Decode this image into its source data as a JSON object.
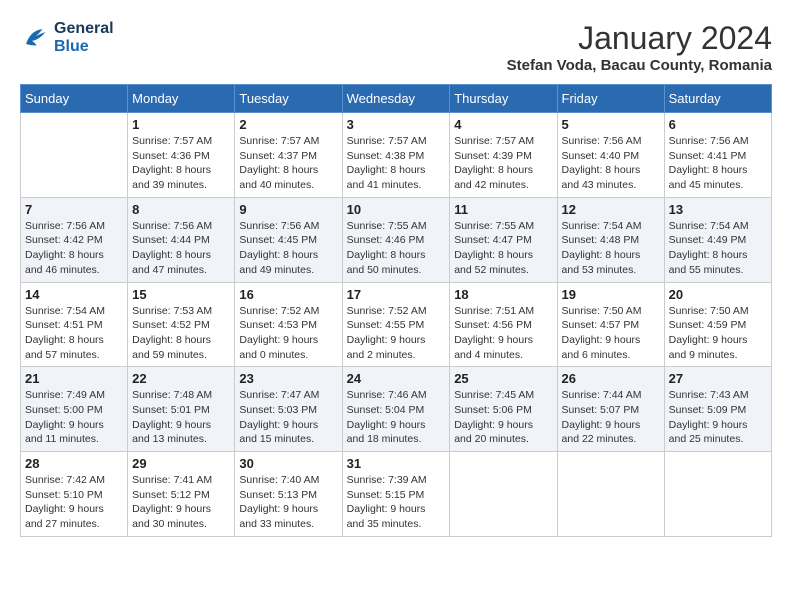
{
  "logo": {
    "line1": "General",
    "line2": "Blue"
  },
  "title": "January 2024",
  "location": "Stefan Voda, Bacau County, Romania",
  "weekdays": [
    "Sunday",
    "Monday",
    "Tuesday",
    "Wednesday",
    "Thursday",
    "Friday",
    "Saturday"
  ],
  "weeks": [
    [
      {
        "day": "",
        "sunrise": "",
        "sunset": "",
        "daylight": ""
      },
      {
        "day": "1",
        "sunrise": "Sunrise: 7:57 AM",
        "sunset": "Sunset: 4:36 PM",
        "daylight": "Daylight: 8 hours and 39 minutes."
      },
      {
        "day": "2",
        "sunrise": "Sunrise: 7:57 AM",
        "sunset": "Sunset: 4:37 PM",
        "daylight": "Daylight: 8 hours and 40 minutes."
      },
      {
        "day": "3",
        "sunrise": "Sunrise: 7:57 AM",
        "sunset": "Sunset: 4:38 PM",
        "daylight": "Daylight: 8 hours and 41 minutes."
      },
      {
        "day": "4",
        "sunrise": "Sunrise: 7:57 AM",
        "sunset": "Sunset: 4:39 PM",
        "daylight": "Daylight: 8 hours and 42 minutes."
      },
      {
        "day": "5",
        "sunrise": "Sunrise: 7:56 AM",
        "sunset": "Sunset: 4:40 PM",
        "daylight": "Daylight: 8 hours and 43 minutes."
      },
      {
        "day": "6",
        "sunrise": "Sunrise: 7:56 AM",
        "sunset": "Sunset: 4:41 PM",
        "daylight": "Daylight: 8 hours and 45 minutes."
      }
    ],
    [
      {
        "day": "7",
        "sunrise": "Sunrise: 7:56 AM",
        "sunset": "Sunset: 4:42 PM",
        "daylight": "Daylight: 8 hours and 46 minutes."
      },
      {
        "day": "8",
        "sunrise": "Sunrise: 7:56 AM",
        "sunset": "Sunset: 4:44 PM",
        "daylight": "Daylight: 8 hours and 47 minutes."
      },
      {
        "day": "9",
        "sunrise": "Sunrise: 7:56 AM",
        "sunset": "Sunset: 4:45 PM",
        "daylight": "Daylight: 8 hours and 49 minutes."
      },
      {
        "day": "10",
        "sunrise": "Sunrise: 7:55 AM",
        "sunset": "Sunset: 4:46 PM",
        "daylight": "Daylight: 8 hours and 50 minutes."
      },
      {
        "day": "11",
        "sunrise": "Sunrise: 7:55 AM",
        "sunset": "Sunset: 4:47 PM",
        "daylight": "Daylight: 8 hours and 52 minutes."
      },
      {
        "day": "12",
        "sunrise": "Sunrise: 7:54 AM",
        "sunset": "Sunset: 4:48 PM",
        "daylight": "Daylight: 8 hours and 53 minutes."
      },
      {
        "day": "13",
        "sunrise": "Sunrise: 7:54 AM",
        "sunset": "Sunset: 4:49 PM",
        "daylight": "Daylight: 8 hours and 55 minutes."
      }
    ],
    [
      {
        "day": "14",
        "sunrise": "Sunrise: 7:54 AM",
        "sunset": "Sunset: 4:51 PM",
        "daylight": "Daylight: 8 hours and 57 minutes."
      },
      {
        "day": "15",
        "sunrise": "Sunrise: 7:53 AM",
        "sunset": "Sunset: 4:52 PM",
        "daylight": "Daylight: 8 hours and 59 minutes."
      },
      {
        "day": "16",
        "sunrise": "Sunrise: 7:52 AM",
        "sunset": "Sunset: 4:53 PM",
        "daylight": "Daylight: 9 hours and 0 minutes."
      },
      {
        "day": "17",
        "sunrise": "Sunrise: 7:52 AM",
        "sunset": "Sunset: 4:55 PM",
        "daylight": "Daylight: 9 hours and 2 minutes."
      },
      {
        "day": "18",
        "sunrise": "Sunrise: 7:51 AM",
        "sunset": "Sunset: 4:56 PM",
        "daylight": "Daylight: 9 hours and 4 minutes."
      },
      {
        "day": "19",
        "sunrise": "Sunrise: 7:50 AM",
        "sunset": "Sunset: 4:57 PM",
        "daylight": "Daylight: 9 hours and 6 minutes."
      },
      {
        "day": "20",
        "sunrise": "Sunrise: 7:50 AM",
        "sunset": "Sunset: 4:59 PM",
        "daylight": "Daylight: 9 hours and 9 minutes."
      }
    ],
    [
      {
        "day": "21",
        "sunrise": "Sunrise: 7:49 AM",
        "sunset": "Sunset: 5:00 PM",
        "daylight": "Daylight: 9 hours and 11 minutes."
      },
      {
        "day": "22",
        "sunrise": "Sunrise: 7:48 AM",
        "sunset": "Sunset: 5:01 PM",
        "daylight": "Daylight: 9 hours and 13 minutes."
      },
      {
        "day": "23",
        "sunrise": "Sunrise: 7:47 AM",
        "sunset": "Sunset: 5:03 PM",
        "daylight": "Daylight: 9 hours and 15 minutes."
      },
      {
        "day": "24",
        "sunrise": "Sunrise: 7:46 AM",
        "sunset": "Sunset: 5:04 PM",
        "daylight": "Daylight: 9 hours and 18 minutes."
      },
      {
        "day": "25",
        "sunrise": "Sunrise: 7:45 AM",
        "sunset": "Sunset: 5:06 PM",
        "daylight": "Daylight: 9 hours and 20 minutes."
      },
      {
        "day": "26",
        "sunrise": "Sunrise: 7:44 AM",
        "sunset": "Sunset: 5:07 PM",
        "daylight": "Daylight: 9 hours and 22 minutes."
      },
      {
        "day": "27",
        "sunrise": "Sunrise: 7:43 AM",
        "sunset": "Sunset: 5:09 PM",
        "daylight": "Daylight: 9 hours and 25 minutes."
      }
    ],
    [
      {
        "day": "28",
        "sunrise": "Sunrise: 7:42 AM",
        "sunset": "Sunset: 5:10 PM",
        "daylight": "Daylight: 9 hours and 27 minutes."
      },
      {
        "day": "29",
        "sunrise": "Sunrise: 7:41 AM",
        "sunset": "Sunset: 5:12 PM",
        "daylight": "Daylight: 9 hours and 30 minutes."
      },
      {
        "day": "30",
        "sunrise": "Sunrise: 7:40 AM",
        "sunset": "Sunset: 5:13 PM",
        "daylight": "Daylight: 9 hours and 33 minutes."
      },
      {
        "day": "31",
        "sunrise": "Sunrise: 7:39 AM",
        "sunset": "Sunset: 5:15 PM",
        "daylight": "Daylight: 9 hours and 35 minutes."
      },
      {
        "day": "",
        "sunrise": "",
        "sunset": "",
        "daylight": ""
      },
      {
        "day": "",
        "sunrise": "",
        "sunset": "",
        "daylight": ""
      },
      {
        "day": "",
        "sunrise": "",
        "sunset": "",
        "daylight": ""
      }
    ]
  ]
}
